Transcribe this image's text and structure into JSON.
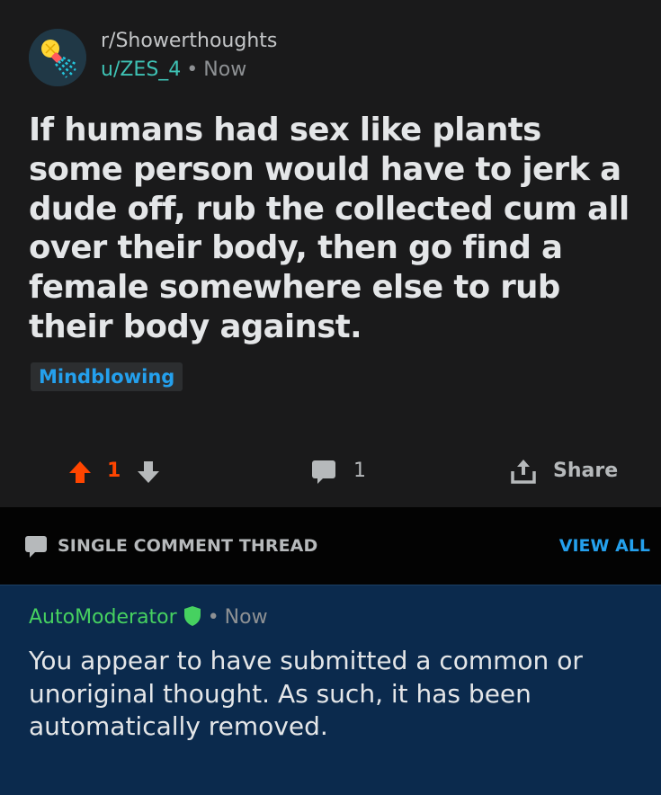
{
  "post": {
    "subreddit": "r/Showerthoughts",
    "username": "u/ZES_4",
    "separator": "•",
    "time": "Now",
    "title": "If humans had sex like plants some person would have to jerk a dude off, rub the collected cum all over their body, then go find a female somewhere else to rub their body against.",
    "flair": "Mindblowing",
    "score": "1",
    "comment_count": "1",
    "share_label": "Share"
  },
  "thread_bar": {
    "label": "SINGLE COMMENT THREAD",
    "view_all": "VIEW ALL"
  },
  "comment": {
    "author": "AutoModerator",
    "separator": "•",
    "time": "Now",
    "body": "You appear to have submitted a common or unoriginal thought. As such, it has been automatically removed."
  },
  "icons": {
    "avatar": "lightbulb-shower-icon",
    "upvote": "upvote-arrow-icon",
    "downvote": "downvote-arrow-icon",
    "comment": "comment-bubble-icon",
    "share": "share-icon",
    "thread": "comment-bubble-icon",
    "moderator": "shield-icon"
  },
  "colors": {
    "background": "#1a1a1b",
    "upvote_active": "#ff4500",
    "username": "#3ec2b4",
    "flair_text": "#24a0ed",
    "link": "#24a0ed",
    "moderator": "#46d160",
    "comment_highlight": "#0b2a4d",
    "thread_bar": "#030303"
  }
}
